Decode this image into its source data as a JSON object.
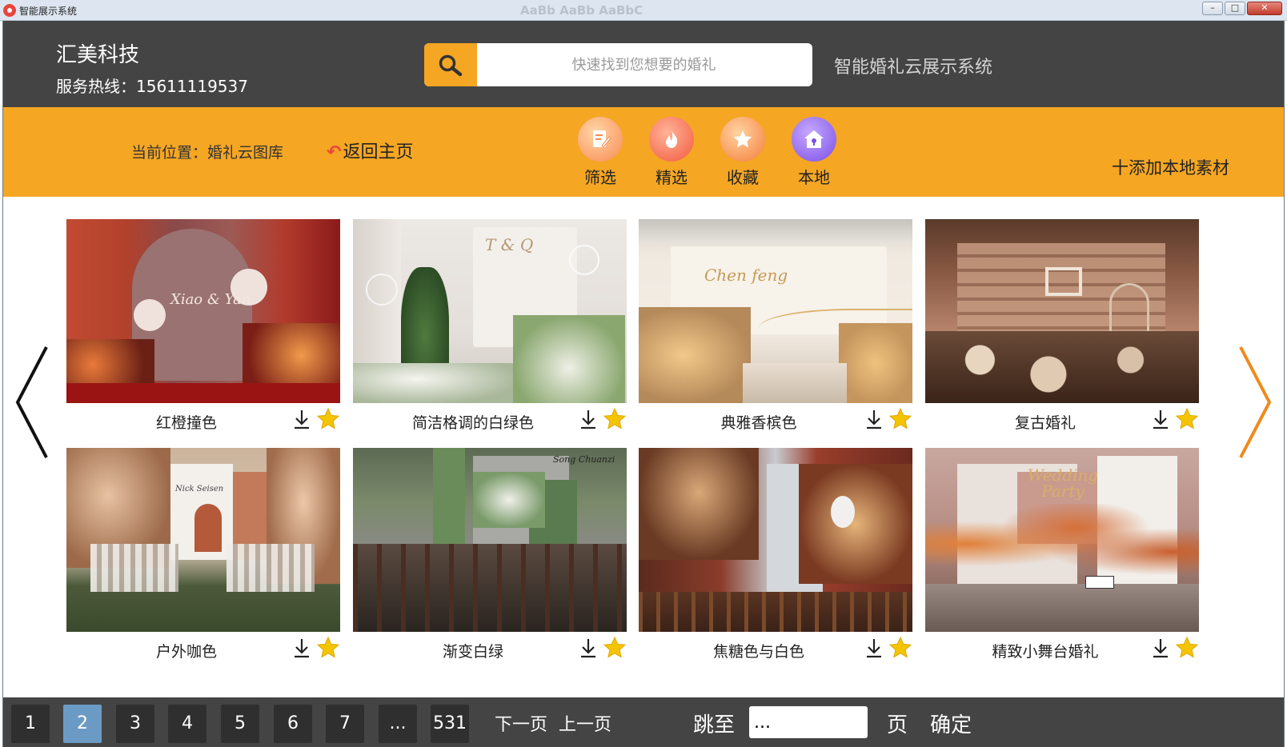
{
  "window": {
    "title": "智能展示系统",
    "min_label": "–",
    "max_label": "□",
    "close_label": "✕"
  },
  "header": {
    "company": "汇美科技",
    "hotline": "服务热线：15611119537",
    "search_placeholder": "快速找到您想要的婚礼",
    "system_name": "智能婚礼云展示系统"
  },
  "toolbar": {
    "location": "当前位置：婚礼云图库",
    "back_home": "返回主页",
    "nav": [
      {
        "label": "筛选",
        "icon": "filter-icon"
      },
      {
        "label": "精选",
        "icon": "fire-icon"
      },
      {
        "label": "收藏",
        "icon": "star-icon"
      },
      {
        "label": "本地",
        "icon": "home-icon"
      }
    ],
    "add_local": "十添加本地素材"
  },
  "gallery": {
    "items": [
      {
        "name": "红橙撞色",
        "script": "Xiao & Yan"
      },
      {
        "name": "简洁格调的白绿色",
        "script": "T & Q"
      },
      {
        "name": "典雅香槟色",
        "script": "Chen feng"
      },
      {
        "name": "复古婚礼",
        "script": ""
      },
      {
        "name": "户外咖色",
        "script": "Nick Seisen"
      },
      {
        "name": "渐变白绿",
        "script": "Song Chuanzi"
      },
      {
        "name": "焦糖色与白色",
        "script": ""
      },
      {
        "name": "精致小舞台婚礼",
        "script": "Wedding Party"
      }
    ]
  },
  "pagination": {
    "pages": [
      "1",
      "2",
      "3",
      "4",
      "5",
      "6",
      "7",
      "...",
      "531"
    ],
    "current": "2",
    "next": "下一页",
    "prev": "上一页",
    "jump_label": "跳至",
    "jump_value": "...",
    "page_unit": "页",
    "confirm": "确定"
  },
  "colors": {
    "header_bg": "#444444",
    "accent": "#f5a623",
    "active_page": "#6b9bc4",
    "star": "#f5c400"
  }
}
